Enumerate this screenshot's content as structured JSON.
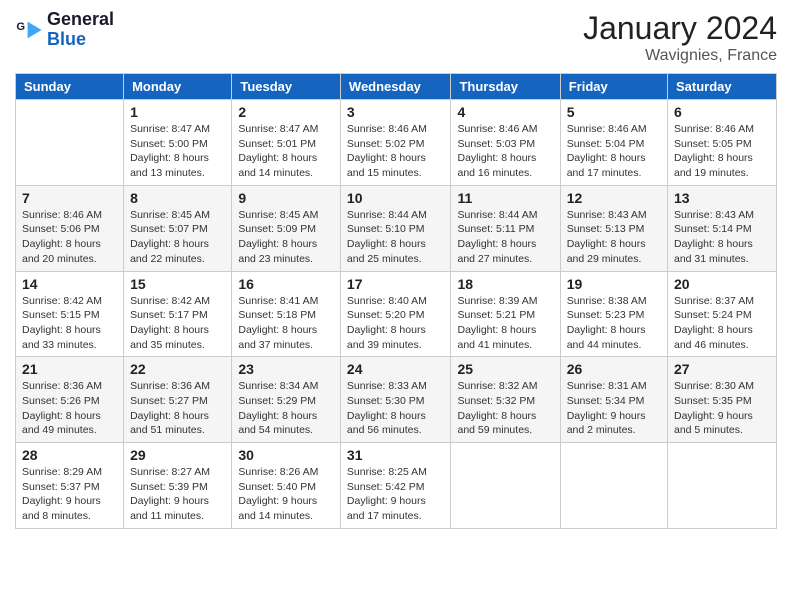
{
  "header": {
    "logo_line1": "General",
    "logo_line2": "Blue",
    "month_year": "January 2024",
    "location": "Wavignies, France"
  },
  "days_of_week": [
    "Sunday",
    "Monday",
    "Tuesday",
    "Wednesday",
    "Thursday",
    "Friday",
    "Saturday"
  ],
  "weeks": [
    [
      {
        "date": "",
        "sunrise": "",
        "sunset": "",
        "daylight": ""
      },
      {
        "date": "1",
        "sunrise": "Sunrise: 8:47 AM",
        "sunset": "Sunset: 5:00 PM",
        "daylight": "Daylight: 8 hours and 13 minutes."
      },
      {
        "date": "2",
        "sunrise": "Sunrise: 8:47 AM",
        "sunset": "Sunset: 5:01 PM",
        "daylight": "Daylight: 8 hours and 14 minutes."
      },
      {
        "date": "3",
        "sunrise": "Sunrise: 8:46 AM",
        "sunset": "Sunset: 5:02 PM",
        "daylight": "Daylight: 8 hours and 15 minutes."
      },
      {
        "date": "4",
        "sunrise": "Sunrise: 8:46 AM",
        "sunset": "Sunset: 5:03 PM",
        "daylight": "Daylight: 8 hours and 16 minutes."
      },
      {
        "date": "5",
        "sunrise": "Sunrise: 8:46 AM",
        "sunset": "Sunset: 5:04 PM",
        "daylight": "Daylight: 8 hours and 17 minutes."
      },
      {
        "date": "6",
        "sunrise": "Sunrise: 8:46 AM",
        "sunset": "Sunset: 5:05 PM",
        "daylight": "Daylight: 8 hours and 19 minutes."
      }
    ],
    [
      {
        "date": "7",
        "sunrise": "Sunrise: 8:46 AM",
        "sunset": "Sunset: 5:06 PM",
        "daylight": "Daylight: 8 hours and 20 minutes."
      },
      {
        "date": "8",
        "sunrise": "Sunrise: 8:45 AM",
        "sunset": "Sunset: 5:07 PM",
        "daylight": "Daylight: 8 hours and 22 minutes."
      },
      {
        "date": "9",
        "sunrise": "Sunrise: 8:45 AM",
        "sunset": "Sunset: 5:09 PM",
        "daylight": "Daylight: 8 hours and 23 minutes."
      },
      {
        "date": "10",
        "sunrise": "Sunrise: 8:44 AM",
        "sunset": "Sunset: 5:10 PM",
        "daylight": "Daylight: 8 hours and 25 minutes."
      },
      {
        "date": "11",
        "sunrise": "Sunrise: 8:44 AM",
        "sunset": "Sunset: 5:11 PM",
        "daylight": "Daylight: 8 hours and 27 minutes."
      },
      {
        "date": "12",
        "sunrise": "Sunrise: 8:43 AM",
        "sunset": "Sunset: 5:13 PM",
        "daylight": "Daylight: 8 hours and 29 minutes."
      },
      {
        "date": "13",
        "sunrise": "Sunrise: 8:43 AM",
        "sunset": "Sunset: 5:14 PM",
        "daylight": "Daylight: 8 hours and 31 minutes."
      }
    ],
    [
      {
        "date": "14",
        "sunrise": "Sunrise: 8:42 AM",
        "sunset": "Sunset: 5:15 PM",
        "daylight": "Daylight: 8 hours and 33 minutes."
      },
      {
        "date": "15",
        "sunrise": "Sunrise: 8:42 AM",
        "sunset": "Sunset: 5:17 PM",
        "daylight": "Daylight: 8 hours and 35 minutes."
      },
      {
        "date": "16",
        "sunrise": "Sunrise: 8:41 AM",
        "sunset": "Sunset: 5:18 PM",
        "daylight": "Daylight: 8 hours and 37 minutes."
      },
      {
        "date": "17",
        "sunrise": "Sunrise: 8:40 AM",
        "sunset": "Sunset: 5:20 PM",
        "daylight": "Daylight: 8 hours and 39 minutes."
      },
      {
        "date": "18",
        "sunrise": "Sunrise: 8:39 AM",
        "sunset": "Sunset: 5:21 PM",
        "daylight": "Daylight: 8 hours and 41 minutes."
      },
      {
        "date": "19",
        "sunrise": "Sunrise: 8:38 AM",
        "sunset": "Sunset: 5:23 PM",
        "daylight": "Daylight: 8 hours and 44 minutes."
      },
      {
        "date": "20",
        "sunrise": "Sunrise: 8:37 AM",
        "sunset": "Sunset: 5:24 PM",
        "daylight": "Daylight: 8 hours and 46 minutes."
      }
    ],
    [
      {
        "date": "21",
        "sunrise": "Sunrise: 8:36 AM",
        "sunset": "Sunset: 5:26 PM",
        "daylight": "Daylight: 8 hours and 49 minutes."
      },
      {
        "date": "22",
        "sunrise": "Sunrise: 8:36 AM",
        "sunset": "Sunset: 5:27 PM",
        "daylight": "Daylight: 8 hours and 51 minutes."
      },
      {
        "date": "23",
        "sunrise": "Sunrise: 8:34 AM",
        "sunset": "Sunset: 5:29 PM",
        "daylight": "Daylight: 8 hours and 54 minutes."
      },
      {
        "date": "24",
        "sunrise": "Sunrise: 8:33 AM",
        "sunset": "Sunset: 5:30 PM",
        "daylight": "Daylight: 8 hours and 56 minutes."
      },
      {
        "date": "25",
        "sunrise": "Sunrise: 8:32 AM",
        "sunset": "Sunset: 5:32 PM",
        "daylight": "Daylight: 8 hours and 59 minutes."
      },
      {
        "date": "26",
        "sunrise": "Sunrise: 8:31 AM",
        "sunset": "Sunset: 5:34 PM",
        "daylight": "Daylight: 9 hours and 2 minutes."
      },
      {
        "date": "27",
        "sunrise": "Sunrise: 8:30 AM",
        "sunset": "Sunset: 5:35 PM",
        "daylight": "Daylight: 9 hours and 5 minutes."
      }
    ],
    [
      {
        "date": "28",
        "sunrise": "Sunrise: 8:29 AM",
        "sunset": "Sunset: 5:37 PM",
        "daylight": "Daylight: 9 hours and 8 minutes."
      },
      {
        "date": "29",
        "sunrise": "Sunrise: 8:27 AM",
        "sunset": "Sunset: 5:39 PM",
        "daylight": "Daylight: 9 hours and 11 minutes."
      },
      {
        "date": "30",
        "sunrise": "Sunrise: 8:26 AM",
        "sunset": "Sunset: 5:40 PM",
        "daylight": "Daylight: 9 hours and 14 minutes."
      },
      {
        "date": "31",
        "sunrise": "Sunrise: 8:25 AM",
        "sunset": "Sunset: 5:42 PM",
        "daylight": "Daylight: 9 hours and 17 minutes."
      },
      {
        "date": "",
        "sunrise": "",
        "sunset": "",
        "daylight": ""
      },
      {
        "date": "",
        "sunrise": "",
        "sunset": "",
        "daylight": ""
      },
      {
        "date": "",
        "sunrise": "",
        "sunset": "",
        "daylight": ""
      }
    ]
  ]
}
